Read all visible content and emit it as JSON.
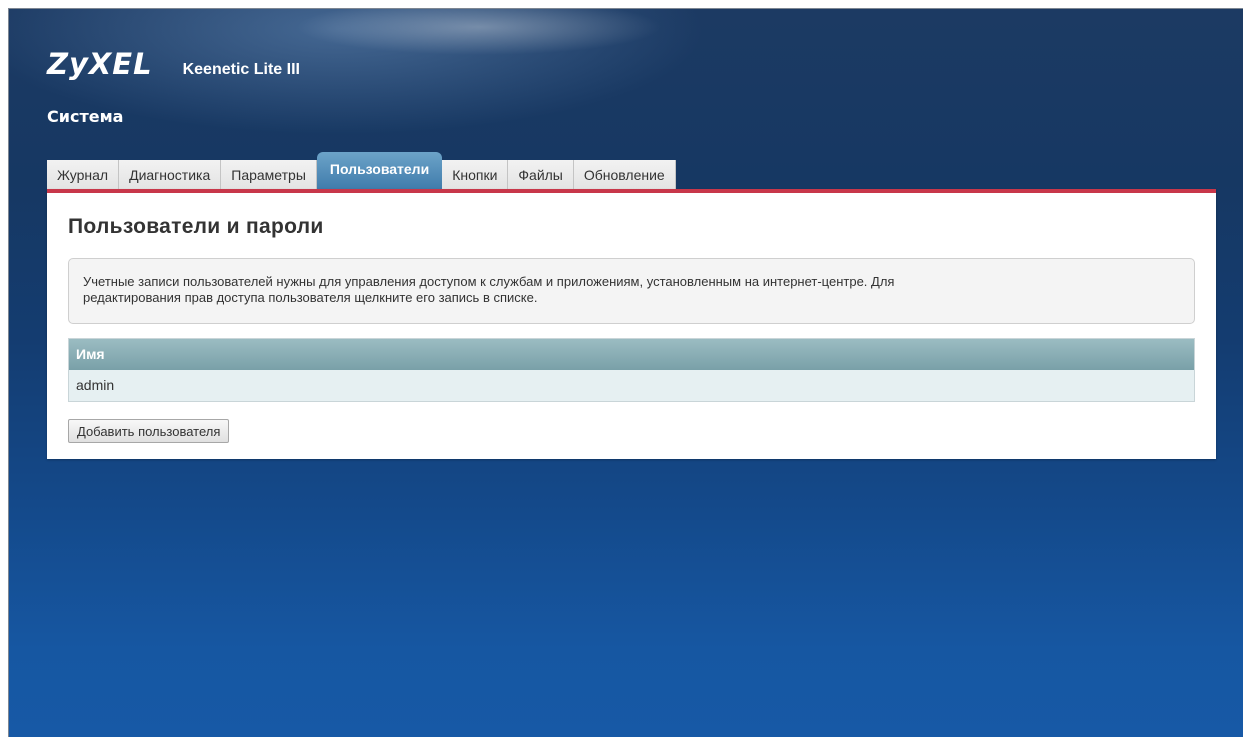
{
  "header": {
    "brand": "ZyXEL",
    "model": "Keenetic Lite III",
    "section_title": "Система"
  },
  "tabs": [
    {
      "label": "Журнал",
      "active": false
    },
    {
      "label": "Диагностика",
      "active": false
    },
    {
      "label": "Параметры",
      "active": false
    },
    {
      "label": "Пользователи",
      "active": true
    },
    {
      "label": "Кнопки",
      "active": false
    },
    {
      "label": "Файлы",
      "active": false
    },
    {
      "label": "Обновление",
      "active": false
    }
  ],
  "main": {
    "title": "Пользователи и пароли",
    "info_line1": "Учетные записи пользователей нужны для управления доступом к службам и приложениям, установленным на интернет-центре. Для",
    "info_line2": "редактирования прав доступа пользователя щелкните его запись в списке.",
    "table": {
      "headers": [
        "Имя"
      ],
      "rows": [
        [
          "admin"
        ]
      ]
    },
    "add_button_label": "Добавить пользователя"
  },
  "colors": {
    "tab_active": "#4f8ab6",
    "panel_accent": "#c8374a",
    "table_header": "#88aeb5",
    "background": "#14427c"
  }
}
